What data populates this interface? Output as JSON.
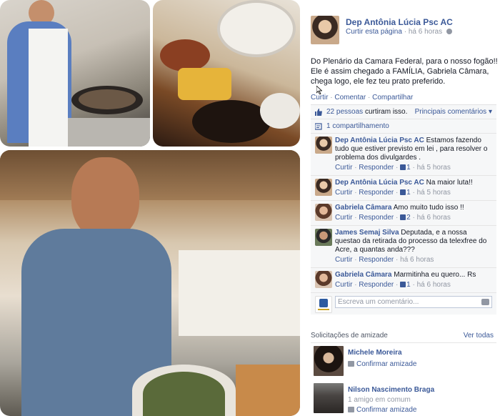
{
  "post": {
    "author": "Dep Antônia Lúcia Psc AC",
    "like_page": "Curtir esta página",
    "time": "há 6 horas",
    "text": "Do Plenário da Camara Federal, para o nosso fogão!! Ele é assim chegado a FAMÍLIA, Gabriela Câmara, chega logo, ele fez teu prato preferido.",
    "actions": {
      "like": "Curtir",
      "comment": "Comentar",
      "share": "Compartilhar"
    }
  },
  "ufi": {
    "likes_count_text": "22 pessoas",
    "likes_suffix": "curtiram isso.",
    "top_comments": "Principais comentários",
    "shares": "1 compartilhamento",
    "comments": [
      {
        "name": "Dep Antônia Lúcia Psc AC",
        "text": "Estamos fazendo tudo que estiver previsto em lei , para resolver o problema dos divulgardes .",
        "likes": "1",
        "time": "há 5 horas"
      },
      {
        "name": "Dep Antônia Lúcia Psc AC",
        "text": "Na maior luta!!",
        "likes": "1",
        "time": "há 5 horas"
      },
      {
        "name": "Gabriela Câmara",
        "text": "Amo muito tudo isso !!",
        "likes": "2",
        "time": "há 6 horas"
      },
      {
        "name": "James Semaj Silva",
        "text": "Deputada, e a nossa questao da retirada do processo da telexfree do Acre, a quantas anda???",
        "likes": "",
        "time": "há 6 horas"
      },
      {
        "name": "Gabriela Câmara",
        "text": "Marmitinha eu quero... Rs",
        "likes": "1",
        "time": "há 6 horas"
      }
    ],
    "comment_actions": {
      "like": "Curtir",
      "reply": "Responder"
    },
    "write_placeholder": "Escreva um comentário..."
  },
  "friends": {
    "title": "Solicitações de amizade",
    "see_all": "Ver todas",
    "items": [
      {
        "name": "Michele Moreira",
        "sub": "",
        "action": "Confirmar amizade"
      },
      {
        "name": "Nilson Nascimento Braga",
        "sub": "1 amigo em comum",
        "action": "Confirmar amizade"
      }
    ]
  },
  "colors": {
    "link": "#3b5998",
    "muted": "#9197a3",
    "ufi_bg": "#f6f7f8"
  }
}
